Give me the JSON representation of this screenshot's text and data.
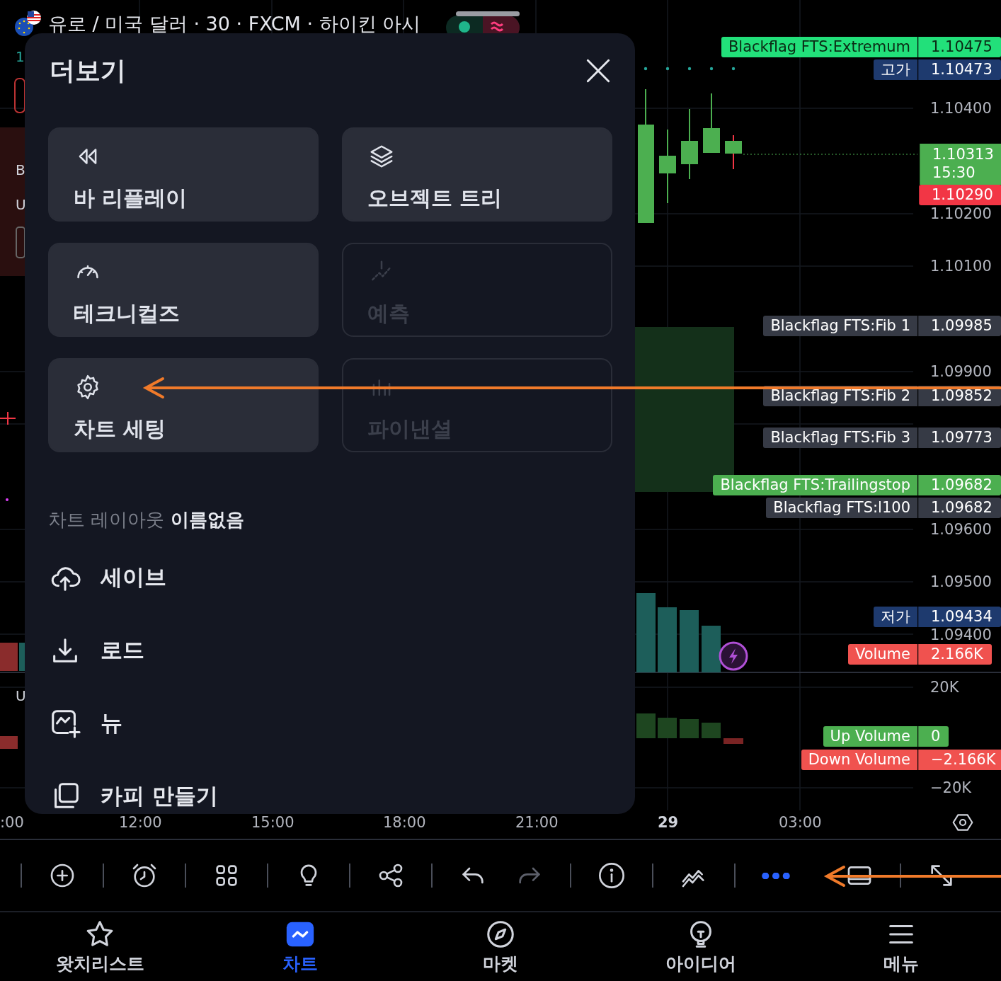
{
  "header": {
    "title": "유로 / 미국 달러 · 30 · FXCM · 하이킨 아시"
  },
  "left_edge": [
    "1",
    "B",
    "U",
    "U"
  ],
  "price_axis": {
    "labels": [
      "1.10400",
      "1.10200",
      "1.10100",
      "1.09900",
      "1.09600",
      "1.09500",
      "1.09400",
      "20K",
      "−20K"
    ]
  },
  "tags": [
    {
      "kind": "named",
      "name": "Blackflag FTS:Extremum",
      "value": "1.10475",
      "color": "#22e07a"
    },
    {
      "kind": "named",
      "name": "고가",
      "value": "1.10473",
      "color": "#1e3a6e"
    },
    {
      "kind": "current",
      "value": "1.10313",
      "countdown": "15:30",
      "color": "#4caf50"
    },
    {
      "kind": "plain",
      "value": "1.10290",
      "color": "#f23645"
    },
    {
      "kind": "named",
      "name": "Blackflag FTS:Fib 1",
      "value": "1.09985",
      "color": "#363a45"
    },
    {
      "kind": "named",
      "name": "Blackflag FTS:Fib 2",
      "value": "1.09852",
      "color": "#363a45"
    },
    {
      "kind": "named",
      "name": "Blackflag FTS:Fib 3",
      "value": "1.09773",
      "color": "#363a45"
    },
    {
      "kind": "named",
      "name": "Blackflag FTS:Trailingstop",
      "value": "1.09682",
      "color": "#4caf50"
    },
    {
      "kind": "named",
      "name": "Blackflag FTS:l100",
      "value": "1.09682",
      "color": "#363a45"
    },
    {
      "kind": "named",
      "name": "저가",
      "value": "1.09434",
      "color": "#1e3a6e"
    },
    {
      "kind": "named",
      "name": "Volume",
      "value": "2.166K",
      "color": "#f0524f"
    },
    {
      "kind": "named",
      "name": "Up Volume",
      "value": "0",
      "color": "#4caf50"
    },
    {
      "kind": "named",
      "name": "Down Volume",
      "value": "−2.166K",
      "color": "#f0524f"
    }
  ],
  "time_axis": {
    "labels": [
      {
        "text": ":00",
        "kind": "time"
      },
      {
        "text": "12:00",
        "kind": "time"
      },
      {
        "text": "15:00",
        "kind": "time"
      },
      {
        "text": "18:00",
        "kind": "time"
      },
      {
        "text": "21:00",
        "kind": "time"
      },
      {
        "text": "29",
        "kind": "day"
      },
      {
        "text": "03:00",
        "kind": "time"
      }
    ]
  },
  "sheet": {
    "title": "더보기",
    "tiles": [
      {
        "label": "바 리플레이",
        "disabled": false
      },
      {
        "label": "오브젝트 트리",
        "disabled": false
      },
      {
        "label": "테크니컬즈",
        "disabled": false
      },
      {
        "label": "예측",
        "disabled": true
      },
      {
        "label": "차트 세팅",
        "disabled": false
      },
      {
        "label": "파이낸셜",
        "disabled": true
      }
    ],
    "layout_name": "차트 레이아웃 **이름없음**",
    "items": [
      "세이브",
      "로드",
      "뉴",
      "카피 만들기"
    ]
  },
  "toolbar": {
    "tools": [
      {
        "selected": false,
        "disabled": false
      },
      {
        "selected": false,
        "disabled": false
      },
      {
        "selected": false,
        "disabled": false
      },
      {
        "selected": false,
        "disabled": false
      },
      {
        "selected": false,
        "disabled": false
      },
      {
        "selected": false,
        "disabled": false
      },
      {
        "selected": false,
        "disabled": true
      },
      {
        "selected": false,
        "disabled": false
      },
      {
        "selected": false,
        "disabled": false
      },
      {
        "selected": true,
        "disabled": false
      },
      {
        "selected": false,
        "disabled": false
      },
      {
        "selected": false,
        "disabled": false
      }
    ]
  },
  "nav": [
    {
      "label": "왓치리스트",
      "selected": false
    },
    {
      "label": "차트",
      "selected": true
    },
    {
      "label": "마켓",
      "selected": false
    },
    {
      "label": "아이디어",
      "selected": false
    },
    {
      "label": "메뉴",
      "selected": false
    }
  ]
}
